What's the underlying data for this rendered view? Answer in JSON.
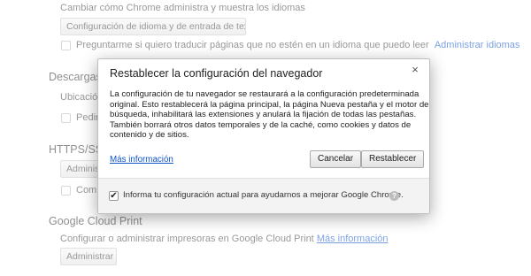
{
  "background": {
    "top_text": "Cambiar cómo Chrome administra y muestra los idiomas",
    "language_button": "Configuración de idioma y de entrada de texto...",
    "translate_checkbox_label": "Preguntarme si quiero traducir páginas que no estén en un idioma que puedo leer",
    "manage_languages_link": "Administrar idiomas",
    "downloads_heading": "Descargas",
    "downloads_location_label": "Ubicación",
    "downloads_ask_label": "Pedir",
    "https_heading": "HTTPS/SSL",
    "certificates_button": "Administ",
    "https_check_label": "Comp",
    "cloud_print_heading": "Google Cloud Print",
    "cloud_print_text": "Configurar o administrar impresoras en Google Cloud Print",
    "cloud_print_link": "Más información",
    "cloud_print_button": "Administrar"
  },
  "dialog": {
    "title": "Restablecer la configuración del navegador",
    "close_symbol": "×",
    "body_lines": [
      "La configuración de tu navegador se restaurará a la configuración predeterminada",
      "original. Esto restablecerá la página principal, la página Nueva pestaña y el motor de",
      "búsqueda, inhabilitará las extensiones y anulará la fijación de todas las pestañas.",
      "También borrará otros datos temporales y de la caché, como cookies y datos de",
      "contenido y de sitios."
    ],
    "learn_more_link": "Más información",
    "cancel_button": "Cancelar",
    "reset_button": "Restablecer",
    "footer_checkbox_checked": true,
    "footer_checkbox_mark": "✔",
    "footer_label": "Informa tu configuración actual para ayudarnos a mejorar Google Chrome.",
    "help_symbol": "?"
  }
}
